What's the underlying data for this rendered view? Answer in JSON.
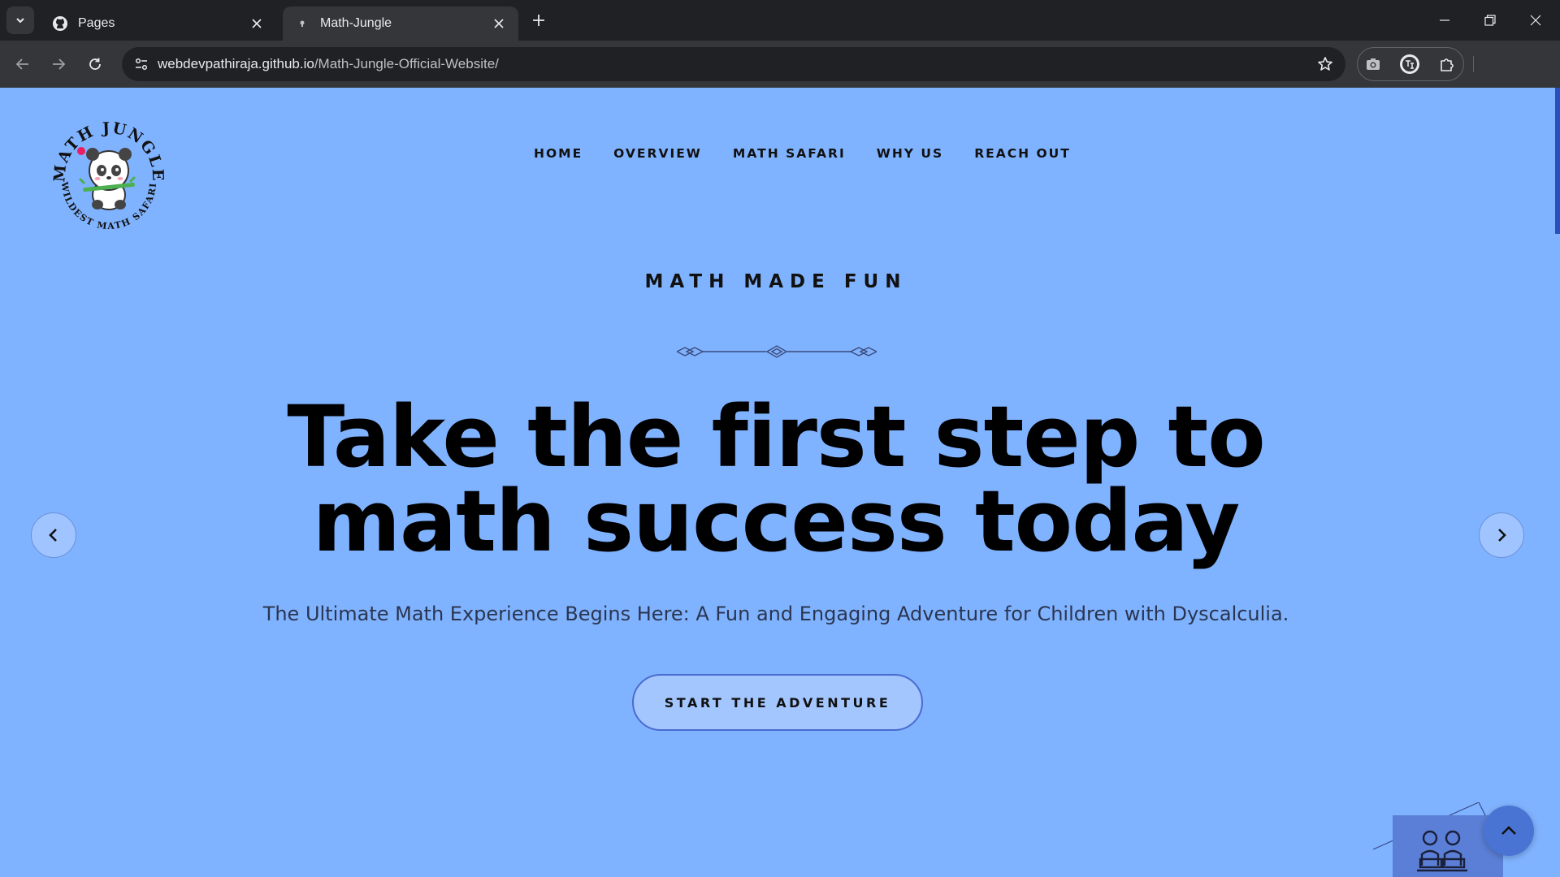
{
  "browser": {
    "tabs": [
      {
        "title": "Pages",
        "icon": "github-icon",
        "active": false
      },
      {
        "title": "Math-Jungle",
        "icon": "site-favicon",
        "active": true
      }
    ],
    "url_host": "webdevpathiraja.github.io",
    "url_path": "/Math-Jungle-Official-Website/"
  },
  "site": {
    "logo": {
      "top_text": "MATH JUNGLE",
      "bottom_text": "WILDEST MATH SAFARI",
      "icon": "panda-mascot-icon"
    },
    "nav": [
      "HOME",
      "OVERVIEW",
      "MATH SAFARI",
      "WHY US",
      "REACH OUT"
    ],
    "hero": {
      "eyebrow": "MATH MADE FUN",
      "headline_line1": "Take the first step to",
      "headline_line2": "math success today",
      "subtitle": "The Ultimate Math Experience Begins Here: A Fun and Engaging Adventure for Children with Dyscalculia.",
      "cta": "START THE ADVENTURE"
    }
  },
  "colors": {
    "page_background": "#80b3ff",
    "cta_background": "#a3c6ff",
    "to_top_button": "#4a74d4",
    "browser_frame": "#202124"
  }
}
